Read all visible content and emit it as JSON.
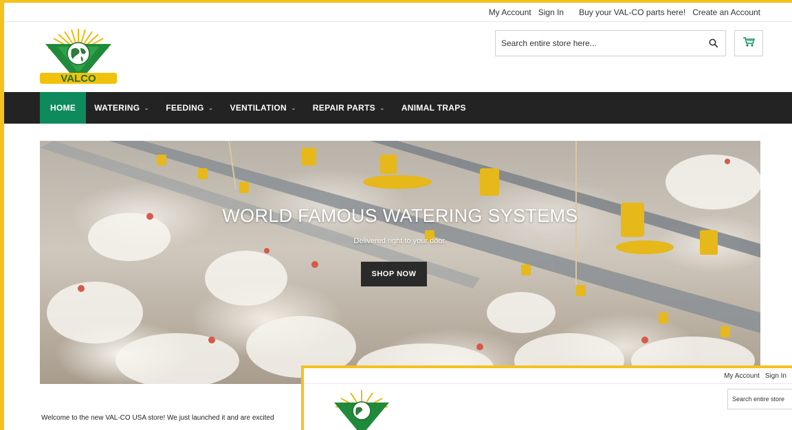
{
  "topbar": {
    "my_account": "My Account",
    "sign_in": "Sign In",
    "parts_promo": "Buy your VAL-CO parts here!",
    "create_account": "Create an Account"
  },
  "logo": {
    "brand": "VALCO"
  },
  "search": {
    "placeholder": "Search entire store here...",
    "icon": "search-icon"
  },
  "cart": {
    "icon": "cart-icon"
  },
  "nav": {
    "items": [
      {
        "label": "HOME",
        "active": true
      },
      {
        "label": "WATERING",
        "dropdown": true
      },
      {
        "label": "FEEDING",
        "dropdown": true
      },
      {
        "label": "VENTILATION",
        "dropdown": true
      },
      {
        "label": "REPAIR PARTS",
        "dropdown": true
      },
      {
        "label": "ANIMAL TRAPS"
      }
    ],
    "chevron": "⌄"
  },
  "hero": {
    "title": "WORLD FAMOUS WATERING SYSTEMS",
    "subtitle": "Delivered right to your door.",
    "button": "SHOP NOW"
  },
  "welcome_text": "Welcome to the new VAL-CO USA store!  We just launched it and are excited",
  "second_window": {
    "my_account": "My Account",
    "sign_in": "Sign In",
    "search_placeholder": "Search entire store"
  },
  "colors": {
    "frame": "#f5c11d",
    "nav_bg": "#232323",
    "nav_active": "#0e8a5c",
    "button_bg": "#2a2a2a"
  }
}
